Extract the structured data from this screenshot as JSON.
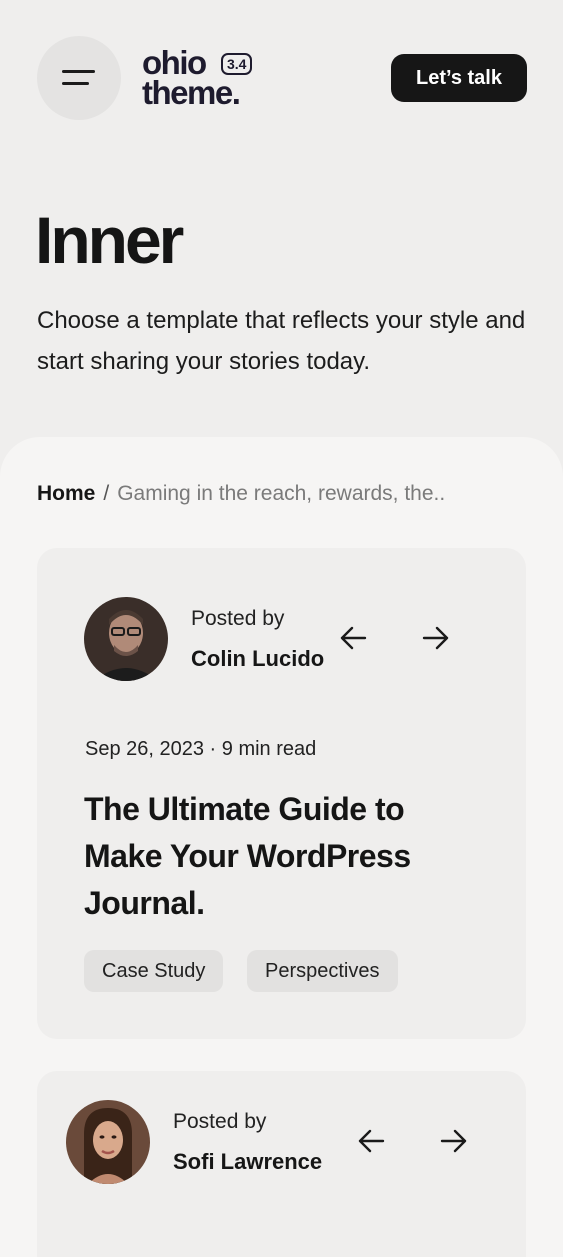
{
  "header": {
    "logo_word1": "ohio",
    "logo_word2": "theme.",
    "logo_version": "3.4",
    "cta_label": "Let’s talk"
  },
  "hero": {
    "title": "Inner",
    "subtitle": "Choose a template that reflects your style and start sharing your stories today."
  },
  "breadcrumb": {
    "home": "Home",
    "separator": "/",
    "current": "Gaming in the reach, rewards, the.."
  },
  "posts": [
    {
      "posted_by_label": "Posted by",
      "author": "Colin Lucido",
      "meta": "Sep 26, 2023 · 9 min read",
      "title": "The Ultimate Guide to Make Your WordPress Journal.",
      "tags": [
        "Case Study",
        "Perspectives"
      ]
    },
    {
      "posted_by_label": "Posted by",
      "author": "Sofi Lawrence"
    }
  ],
  "icons": {
    "menu": "hamburger-icon",
    "prev": "arrow-left-icon",
    "next": "arrow-right-icon"
  },
  "colors": {
    "background": "#efeeed",
    "panel": "#f6f5f4",
    "card": "#efeeed",
    "button": "#161616",
    "tag": "#e2e1e0"
  }
}
